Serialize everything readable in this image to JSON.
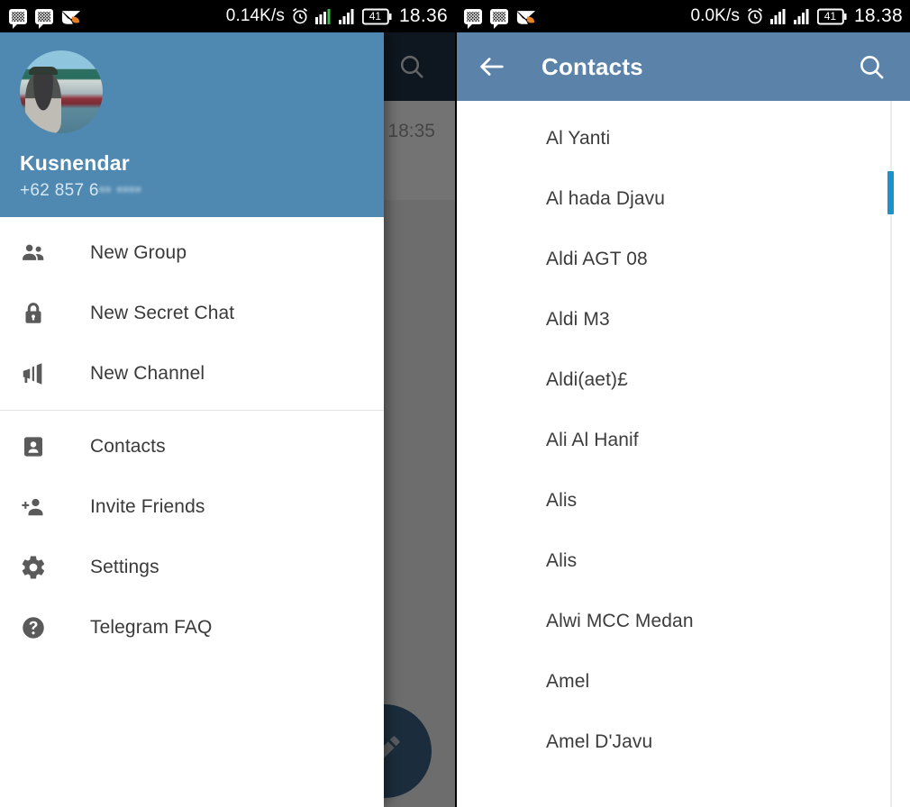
{
  "left": {
    "statusbar": {
      "icons": [
        "bbm-icon",
        "bbm-icon",
        "mail-call-icon"
      ],
      "network_speed": "0.14K/s",
      "alarm_icon": "alarm-icon",
      "signal_icons": [
        "signal-bars-icon",
        "signal-bars-icon"
      ],
      "battery_level": "41",
      "clock": "18.36"
    },
    "background": {
      "search_icon": "search-icon",
      "message_time": "18:35",
      "read_check_icon": "double-check-icon",
      "fab_icon": "compose-pencil-icon"
    },
    "drawer": {
      "avatar": "user-avatar-photo",
      "name": "Kusnendar",
      "phone_prefix": "+62 857 6",
      "phone_redacted": "•• ••••",
      "items_group1": [
        {
          "label": "New Group",
          "icon": "group-icon"
        },
        {
          "label": "New Secret Chat",
          "icon": "lock-icon"
        },
        {
          "label": "New Channel",
          "icon": "megaphone-icon"
        }
      ],
      "items_group2": [
        {
          "label": "Contacts",
          "icon": "contact-card-icon"
        },
        {
          "label": "Invite Friends",
          "icon": "person-add-icon"
        },
        {
          "label": "Settings",
          "icon": "gear-icon"
        },
        {
          "label": "Telegram FAQ",
          "icon": "help-circle-icon"
        }
      ]
    }
  },
  "right": {
    "statusbar": {
      "icons": [
        "bbm-icon",
        "bbm-icon",
        "mail-call-icon"
      ],
      "network_speed": "0.0K/s",
      "alarm_icon": "alarm-icon",
      "signal_icons": [
        "signal-bars-icon",
        "signal-bars-icon"
      ],
      "battery_level": "41",
      "clock": "18.38"
    },
    "toolbar": {
      "back_icon": "back-arrow-icon",
      "title": "Contacts",
      "search_icon": "search-icon"
    },
    "contacts": [
      "Al Yanti",
      "Al hada Djavu",
      "Aldi AGT 08",
      "Aldi M3",
      "Aldi(aet)£",
      "Ali Al Hanif",
      "Alis",
      "Alis",
      "Alwi MCC Medan",
      "Amel",
      "Amel D'Javu"
    ],
    "scrollbar": "contacts-scrollbar"
  },
  "colors": {
    "drawer_header": "#4f88b0",
    "toolbar": "#5b82a8",
    "background_toolbar": "#1f3146",
    "scrollbar_thumb": "#1b93c8",
    "fab": "#3c6586"
  }
}
